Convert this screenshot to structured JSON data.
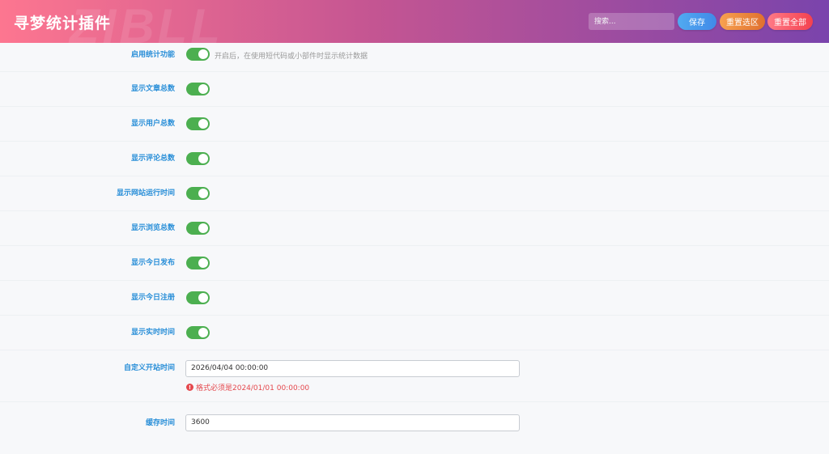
{
  "header": {
    "title": "寻梦统计插件",
    "watermark": "ZIBLL",
    "search_placeholder": "搜索...",
    "save_label": "保存",
    "reset_section_label": "重置选区",
    "reset_all_label": "重置全部"
  },
  "settings": {
    "enable": {
      "label": "启用统计功能",
      "hint": "开启后，在使用短代码或小部件时显示统计数据",
      "on": true
    },
    "toggles": [
      {
        "label": "显示文章总数",
        "on": true
      },
      {
        "label": "显示用户总数",
        "on": true
      },
      {
        "label": "显示评论总数",
        "on": true
      },
      {
        "label": "显示网站运行时间",
        "on": true
      },
      {
        "label": "显示浏览总数",
        "on": true
      },
      {
        "label": "显示今日发布",
        "on": true
      },
      {
        "label": "显示今日注册",
        "on": true
      },
      {
        "label": "显示实时时间",
        "on": true
      }
    ],
    "start_time": {
      "label": "自定义开站时间",
      "value": "2026/04/04 00:00:00",
      "error": "格式必须是2024/01/01 00:00:00"
    },
    "cache_time": {
      "label": "缓存时间",
      "value": "3600"
    }
  },
  "colors": {
    "toggle_on": "#4caf50",
    "label": "#2a8fd8",
    "error": "#e5484d"
  }
}
